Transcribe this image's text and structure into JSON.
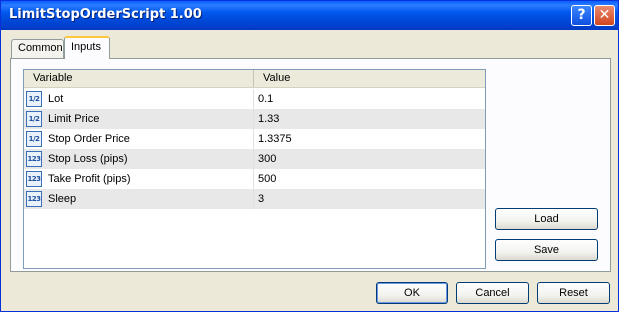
{
  "window": {
    "title": "LimitStopOrderScript 1.00"
  },
  "titlebar_buttons": {
    "help": "?",
    "close": "✕"
  },
  "tabs": [
    {
      "label": "Common",
      "active": false
    },
    {
      "label": "Inputs",
      "active": true
    }
  ],
  "table": {
    "columns": [
      "Variable",
      "Value"
    ],
    "rows": [
      {
        "icon": "fraction-icon",
        "icon_text": "1/2",
        "name": "Lot",
        "value": "0.1"
      },
      {
        "icon": "fraction-icon",
        "icon_text": "1/2",
        "name": "Limit Price",
        "value": "1.33"
      },
      {
        "icon": "fraction-icon",
        "icon_text": "1/2",
        "name": "Stop Order Price",
        "value": "1.3375"
      },
      {
        "icon": "integer-icon",
        "icon_text": "123",
        "name": "Stop Loss (pips)",
        "value": "300"
      },
      {
        "icon": "integer-icon",
        "icon_text": "123",
        "name": "Take Profit (pips)",
        "value": "500"
      },
      {
        "icon": "integer-icon",
        "icon_text": "123",
        "name": "Sleep",
        "value": "3"
      }
    ]
  },
  "side_buttons": {
    "load": "Load",
    "save": "Save"
  },
  "footer_buttons": {
    "ok": "OK",
    "cancel": "Cancel",
    "reset": "Reset"
  }
}
